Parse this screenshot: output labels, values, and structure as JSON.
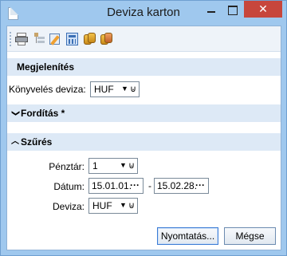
{
  "window": {
    "title": "Deviza karton",
    "close_glyph": "✕"
  },
  "toolbar": {
    "icons": [
      "printer-icon",
      "tree-icon",
      "edit-icon",
      "calculator-icon",
      "coins-icon",
      "coins-export-icon"
    ]
  },
  "sections": {
    "display": {
      "title": "Megjelenítés"
    },
    "translation": {
      "title": "Fordítás *",
      "chevron": "❯"
    },
    "filter": {
      "title": "Szűrés",
      "chevron": "︿"
    }
  },
  "display": {
    "accounting_currency_label": "Könyvelés deviza:",
    "accounting_currency_value": "HUF"
  },
  "filter": {
    "cashdesk_label": "Pénztár:",
    "cashdesk_value": "1",
    "date_label": "Dátum:",
    "date_from": "15.01.01.",
    "date_to": "15.02.28.",
    "date_separator": "-",
    "currency_label": "Deviza:",
    "currency_value": "HUF"
  },
  "combo": {
    "arrow": "▼",
    "clip": "⊍",
    "dots": "···"
  },
  "footer": {
    "print_label": "Nyomtatás...",
    "cancel_label": "Mégse"
  }
}
